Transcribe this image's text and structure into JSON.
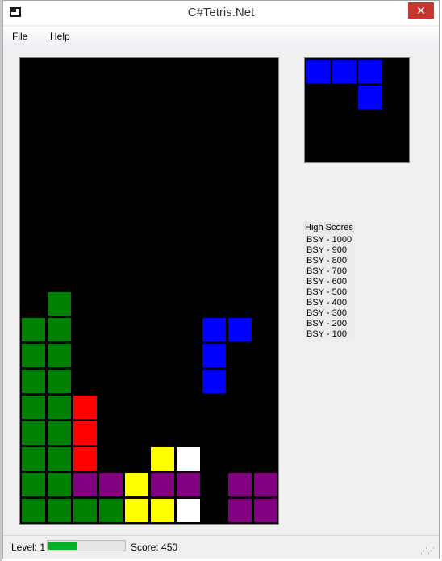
{
  "window": {
    "title": "C#Tetris.Net",
    "close_glyph": "✕"
  },
  "menu": {
    "items": [
      "File",
      "Help"
    ]
  },
  "board": {
    "columns": 10,
    "rows": 18,
    "colors": {
      "G": "#008000",
      "R": "#ff0000",
      "B": "#0000ff",
      "Y": "#ffff00",
      "W": "#ffffff",
      "P": "#800080"
    },
    "grid": [
      "..........",
      "..........",
      "..........",
      "..........",
      "..........",
      "..........",
      "..........",
      "..........",
      "..........",
      ".G........",
      "GG.....BB.",
      "GG.....B..",
      "GG.....B..",
      "GGR.......",
      "GGR.......",
      "GGR..YW...",
      "GGPPYPP.PP",
      "GGGGYYW.PP"
    ]
  },
  "next_piece": {
    "color": "#0000ff",
    "grid": [
      "BBB.",
      "..B.",
      "....",
      "...."
    ]
  },
  "high_scores": {
    "title": "High Scores",
    "entries": [
      "BSY - 1000",
      "BSY - 900",
      "BSY - 800",
      "BSY - 700",
      "BSY - 600",
      "BSY - 500",
      "BSY - 400",
      "BSY - 300",
      "BSY - 200",
      "BSY - 100"
    ]
  },
  "status": {
    "level_text": "Level: 1",
    "score_text": "Score: 450",
    "level_progress": 0.38,
    "progress_color": "#06b025"
  }
}
